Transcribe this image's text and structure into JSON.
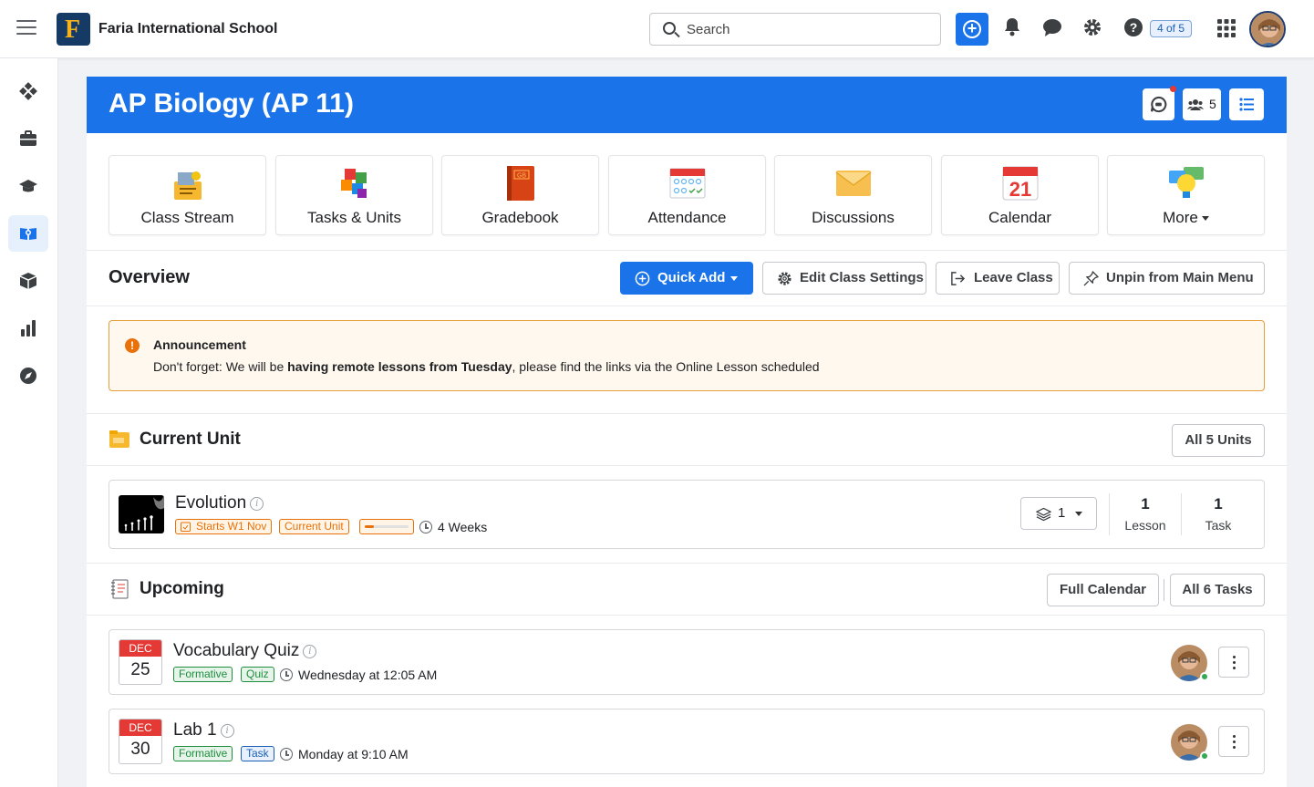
{
  "app": {
    "school_name": "Faria International School",
    "search_placeholder": "Search",
    "help_badge": "4 of 5"
  },
  "class": {
    "title": "AP Biology (AP 11)",
    "member_count": "5"
  },
  "tiles": [
    {
      "label": "Class Stream",
      "icon": "class-stream-icon"
    },
    {
      "label": "Tasks & Units",
      "icon": "puzzle-icon"
    },
    {
      "label": "Gradebook",
      "icon": "gradebook-icon"
    },
    {
      "label": "Attendance",
      "icon": "attendance-icon"
    },
    {
      "label": "Discussions",
      "icon": "envelope-icon"
    },
    {
      "label": "Calendar",
      "icon": "calendar-icon"
    },
    {
      "label": "More",
      "icon": "lightbulb-icon"
    }
  ],
  "calendar_tile_day": "21",
  "overview": {
    "title": "Overview",
    "quick_add": "Quick Add",
    "edit_settings": "Edit Class Settings",
    "leave_class": "Leave Class",
    "unpin": "Unpin from Main Menu"
  },
  "announcement": {
    "title": "Announcement",
    "before": "Don't forget: We will be ",
    "bold": "having remote lessons from Tuesday",
    "after": ", please find the links via the Online Lesson scheduled"
  },
  "current_unit": {
    "section_title": "Current Unit",
    "all_units_button": "All 5 Units",
    "name": "Evolution",
    "starts_tag": "Starts W1 Nov",
    "status_tag": "Current Unit",
    "progress": 0.2,
    "duration": "4 Weeks",
    "layers_count": "1",
    "lesson_count": "1",
    "lesson_label": "Lesson",
    "task_count": "1",
    "task_label": "Task"
  },
  "upcoming": {
    "section_title": "Upcoming",
    "full_calendar_button": "Full Calendar",
    "all_tasks_button": "All 6 Tasks",
    "tasks": [
      {
        "month": "DEC",
        "day": "25",
        "name": "Vocabulary Quiz",
        "tags": [
          "Formative",
          "Quiz"
        ],
        "when": "Wednesday at 12:05 AM"
      },
      {
        "month": "DEC",
        "day": "30",
        "name": "Lab 1",
        "tags": [
          "Formative",
          "Task"
        ],
        "when": "Monday at 9:10 AM"
      }
    ]
  },
  "colors": {
    "primary": "#1a73e8",
    "announcement_border": "#e69e3b",
    "warning": "#e8710a",
    "formative": "#1e8e3e",
    "date_header": "#e53935"
  }
}
